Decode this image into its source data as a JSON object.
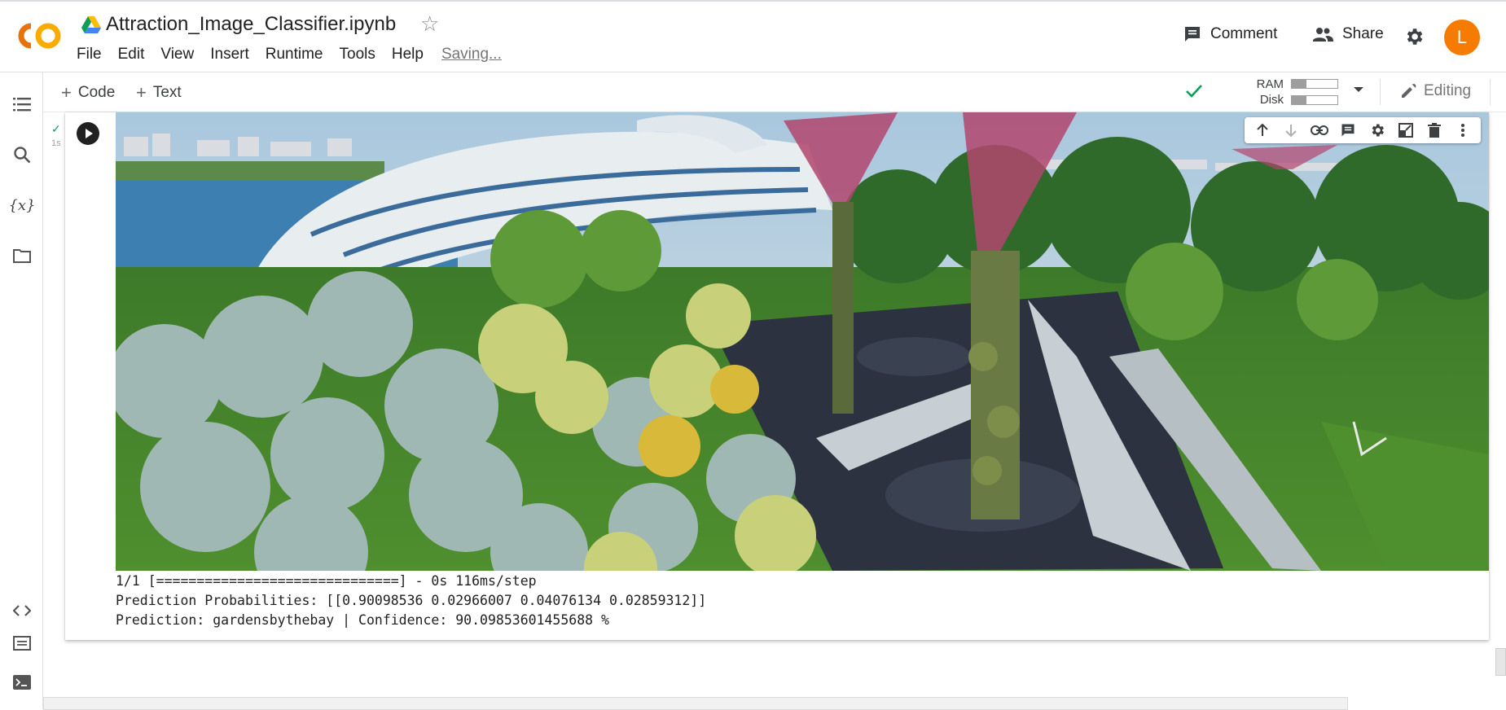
{
  "header": {
    "title": "Attraction_Image_Classifier.ipynb",
    "menu": [
      "File",
      "Edit",
      "View",
      "Insert",
      "Runtime",
      "Tools",
      "Help"
    ],
    "status": "Saving...",
    "comment_label": "Comment",
    "share_label": "Share",
    "avatar_initial": "L",
    "avatar_color": "#f57c00"
  },
  "toolbar": {
    "add_code": "Code",
    "add_text": "Text",
    "ram_label": "RAM",
    "disk_label": "Disk",
    "ram_usage": 0.32,
    "disk_usage": 0.32,
    "editing_label": "Editing"
  },
  "cell": {
    "exec_time": "1s",
    "output_image": "Gardens by the Bay — Supertrees and Flower Dome",
    "output_lines": [
      "1/1 [==============================] - 0s 116ms/step",
      "Prediction Probabilities: [[0.90098536 0.02966007 0.04076134 0.02859312]]",
      "Prediction: gardensbythebay | Confidence: 90.09853601455688 %"
    ]
  },
  "icons": {
    "rail": [
      "toc-icon",
      "search-icon",
      "variables-icon",
      "folder-icon",
      "code-snippets-icon",
      "command-palette-icon",
      "terminal-icon"
    ],
    "cell_tools": [
      "move-up-icon",
      "move-down-icon",
      "link-icon",
      "comment-icon",
      "settings-icon",
      "mirror-cell-icon",
      "delete-icon",
      "more-icon"
    ]
  },
  "colors": {
    "accent_green": "#0f9d58",
    "logo_orange": "#f9ab00",
    "logo_dark_orange": "#e8710a"
  }
}
